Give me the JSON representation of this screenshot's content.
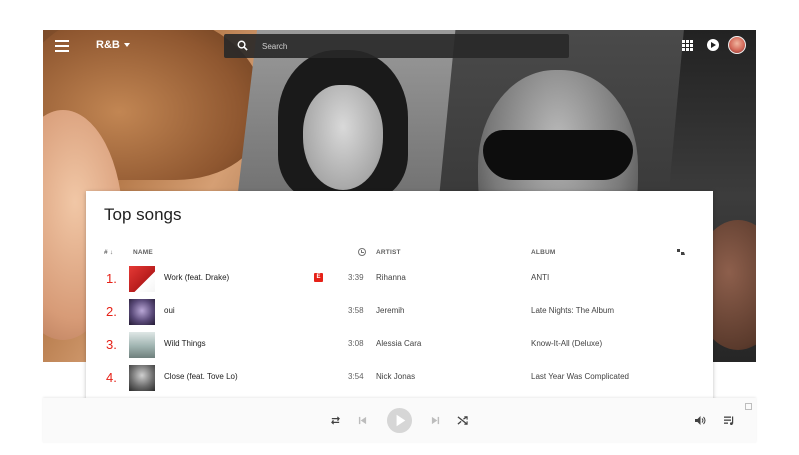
{
  "header": {
    "genre": "R&B",
    "search_placeholder": "Search"
  },
  "card": {
    "title": "Top songs",
    "columns": {
      "number": "#",
      "name": "NAME",
      "artist": "ARTIST",
      "album": "ALBUM"
    },
    "songs": [
      {
        "rank": "1.",
        "name": "Work (feat. Drake)",
        "explicit": "E",
        "duration": "3:39",
        "artist": "Rihanna",
        "album": "ANTI",
        "thumb_color": "#d32f2f"
      },
      {
        "rank": "2.",
        "name": "oui",
        "explicit": "",
        "duration": "3:58",
        "artist": "Jeremih",
        "album": "Late Nights: The Album",
        "thumb_color": "#5b4b7a"
      },
      {
        "rank": "3.",
        "name": "Wild Things",
        "explicit": "",
        "duration": "3:08",
        "artist": "Alessia Cara",
        "album": "Know-It-All (Deluxe)",
        "thumb_color": "#9fb3b0"
      },
      {
        "rank": "4.",
        "name": "Close (feat. Tove Lo)",
        "explicit": "",
        "duration": "3:54",
        "artist": "Nick Jonas",
        "album": "Last Year Was Complicated",
        "thumb_color": "#6d6d6d"
      }
    ]
  },
  "colors": {
    "accent": "#e62117",
    "text_primary": "#212121",
    "text_secondary": "#616161"
  },
  "icons": [
    "menu-icon",
    "search-icon",
    "apps-icon",
    "cast-icon",
    "clock-icon",
    "thumbs-icon",
    "repeat-icon",
    "previous-icon",
    "play-icon",
    "next-icon",
    "shuffle-icon",
    "volume-icon",
    "queue-icon",
    "popout-icon"
  ]
}
